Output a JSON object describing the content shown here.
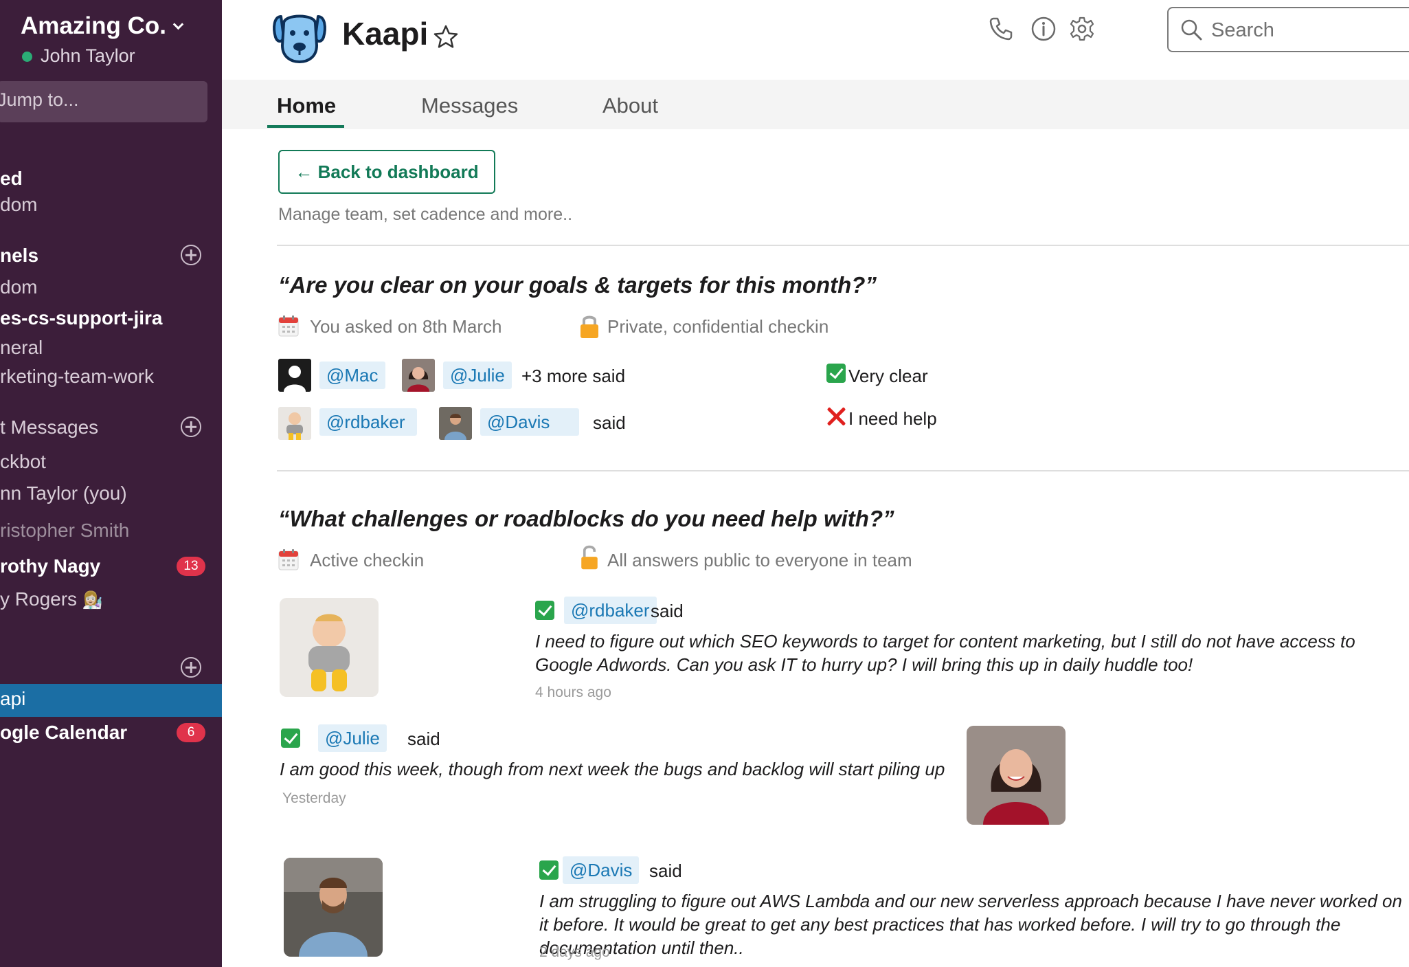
{
  "workspace": {
    "name": "Amazing Co.",
    "user": "John Taylor"
  },
  "sidebar": {
    "jump_placeholder": "Jump to...",
    "starred": {
      "heading": "ed",
      "items": [
        "dom"
      ]
    },
    "channels": {
      "heading": "nels",
      "items": [
        {
          "label": "dom",
          "style": "light"
        },
        {
          "label": "es-cs-support-jira",
          "style": "bold"
        },
        {
          "label": "neral",
          "style": "light"
        },
        {
          "label": "rketing-team-work",
          "style": "light"
        }
      ]
    },
    "dms": {
      "heading": "t Messages",
      "items": [
        {
          "label": "ckbot",
          "style": "light"
        },
        {
          "label": "nn Taylor (you)",
          "style": "light"
        },
        {
          "label": "ristopher Smith",
          "style": "dim"
        },
        {
          "label": "rothy Nagy",
          "style": "bold",
          "badge": "13"
        },
        {
          "label": "y Rogers",
          "style": "light",
          "emoji": "👩🏼‍🔬"
        }
      ]
    },
    "apps": {
      "heading": "",
      "items": [
        {
          "label": "api",
          "style": "active"
        },
        {
          "label": "ogle Calendar",
          "style": "bold",
          "badge": "6"
        }
      ]
    }
  },
  "header": {
    "app_name": "Kaapi",
    "search_placeholder": "Search"
  },
  "tabs": [
    {
      "label": "Home",
      "active": true
    },
    {
      "label": "Messages",
      "active": false
    },
    {
      "label": "About",
      "active": false
    }
  ],
  "main": {
    "back_button": "← Back to dashboard",
    "manage_text": "Manage team, set cadence and more..",
    "checkin1": {
      "question": "“Are you clear on your goals & targets for this month?”",
      "asked": "You asked on 8th March",
      "privacy": "Private, confidential checkin",
      "row1": {
        "users": [
          "@Mac",
          "@Julie"
        ],
        "suffix": "+3 more said",
        "answer": "Very clear"
      },
      "row2": {
        "users": [
          "@rdbaker",
          "@Davis"
        ],
        "suffix": "said",
        "answer": "I need help"
      }
    },
    "checkin2": {
      "question": "“What challenges or roadblocks do you need help with?”",
      "status": "Active checkin",
      "privacy": "All answers public to everyone in team",
      "answers": [
        {
          "user": "@rdbaker",
          "said": "said",
          "text": "I need to figure out which SEO keywords to target for content marketing, but I still do not have access to Google Adwords. Can you ask IT to hurry up? I will bring this up in daily huddle too!",
          "time": "4 hours ago"
        },
        {
          "user": "@Julie",
          "said": "said",
          "text": "I am good this week, though from next week the bugs and backlog will start piling up",
          "time": "Yesterday"
        },
        {
          "user": "@Davis",
          "said": "said",
          "text": "I am struggling to figure out AWS Lambda and our new serverless approach because I have never worked on it before. It would be great to get any best practices that has worked before. I will try to go through the documentation until then..",
          "time": "2 days ago"
        }
      ]
    }
  },
  "colors": {
    "sidebar_bg": "#3c1e3a",
    "active_item": "#1b6ea4",
    "accent_green": "#127a57",
    "mention_bg": "#e3f0f9",
    "mention_text": "#1a78b4",
    "badge": "#e0334b"
  }
}
